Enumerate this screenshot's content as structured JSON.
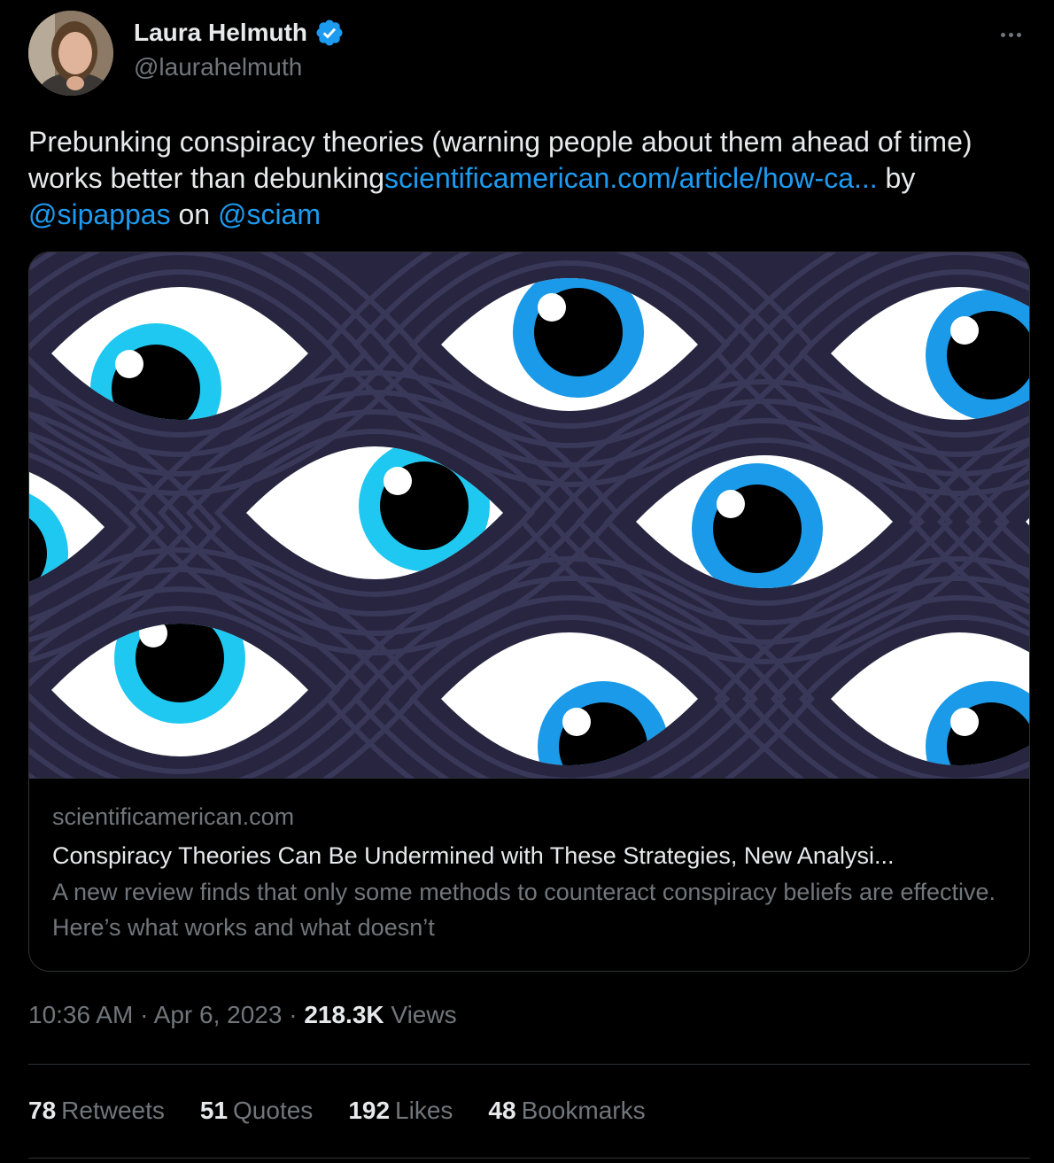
{
  "author": {
    "display_name": "Laura Helmuth",
    "handle": "@laurahelmuth",
    "verified_icon": "verified-badge-icon",
    "avatar_color": "#6d5a48"
  },
  "tweet": {
    "text_plain": "Prebunking conspiracy theories (warning people about them ahead of time) works better than debunking",
    "link_text": "scientificamerican.com/article/how-ca...",
    "by_text": " by ",
    "mention_1": "@sipappas",
    "on_text": " on ",
    "mention_2": "@sciam"
  },
  "card": {
    "domain": "scientificamerican.com",
    "title": "Conspiracy Theories Can Be Undermined with These Strategies, New Analysi...",
    "description": "A new review finds that only some methods to counteract conspiracy beliefs are effective. Here’s what works and what doesn’t",
    "image_bg": "#27253f",
    "iris_colors": [
      "#1ec8f0",
      "#1a9ae8"
    ]
  },
  "meta": {
    "time": "10:36 AM",
    "sep1": " · ",
    "date": "Apr 6, 2023",
    "sep2": " · ",
    "views_count": "218.3K",
    "views_label": " Views"
  },
  "stats": [
    {
      "count": "78",
      "label": "Retweets"
    },
    {
      "count": "51",
      "label": "Quotes"
    },
    {
      "count": "192",
      "label": "Likes"
    },
    {
      "count": "48",
      "label": "Bookmarks"
    }
  ]
}
